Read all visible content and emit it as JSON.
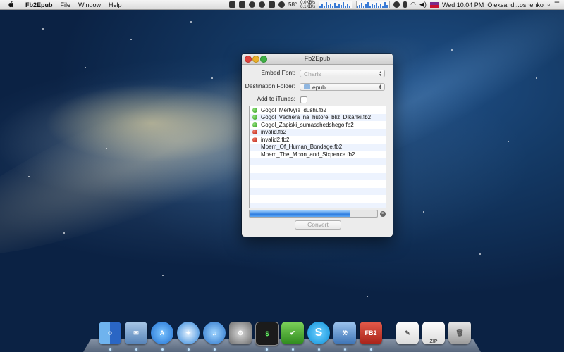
{
  "menubar": {
    "app_name": "Fb2Epub",
    "menus": [
      "File",
      "Window",
      "Help"
    ],
    "temperature": "58°",
    "net_up": "0.0KB/s",
    "net_down": "0.1KB/s",
    "clock": "Wed 10:04 PM",
    "user": "Oleksand...oshenko"
  },
  "window": {
    "title": "Fb2Epub",
    "embed_font_label": "Embed Font:",
    "embed_font_value": "Charis",
    "destination_label": "Destination Folder:",
    "destination_value": "epub",
    "itunes_label": "Add to iTunes:",
    "itunes_checked": false,
    "files": [
      {
        "name": "Gogol_Mertvyie_dushi.fb2",
        "status": "ok"
      },
      {
        "name": "Gogol_Vechera_na_hutore_bliz_Dikanki.fb2",
        "status": "ok"
      },
      {
        "name": "Gogol_Zapiski_sumasshedshego.fb2",
        "status": "ok"
      },
      {
        "name": "invalid.fb2",
        "status": "error"
      },
      {
        "name": "invalid2.fb2",
        "status": "error"
      },
      {
        "name": "Moem_Of_Human_Bondage.fb2",
        "status": "pending"
      },
      {
        "name": "Moem_The_Moon_and_Sixpence.fb2",
        "status": "pending"
      }
    ],
    "progress": 0.79,
    "convert_label": "Convert"
  },
  "dock": {
    "apps": [
      "finder-icon",
      "mail-icon",
      "app-store-icon",
      "safari-icon",
      "itunes-icon",
      "system-preferences-icon",
      "terminal-icon",
      "textmate-icon",
      "skype-icon",
      "xcode-icon",
      "fb2epub-icon",
      "document-icon",
      "zip-icon",
      "trash-icon"
    ],
    "fb2_badge": "FB2",
    "zip_badge": "ZIP",
    "terminal_badge": "$"
  }
}
